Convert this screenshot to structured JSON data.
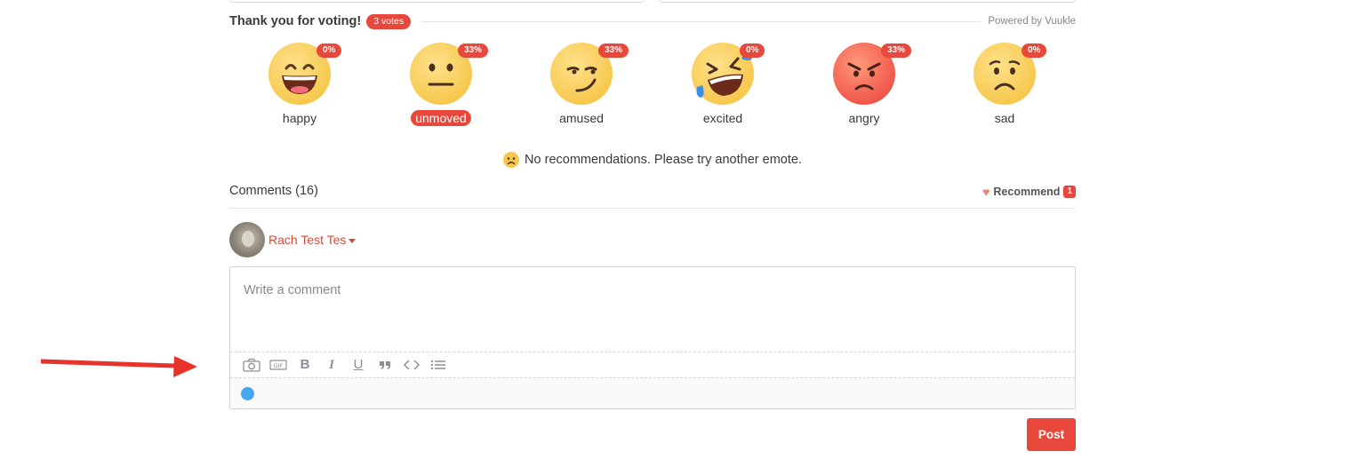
{
  "vote_header": {
    "title": "Thank you for voting!",
    "votes_badge": "3 votes",
    "powered_by": "Powered by Vuukle"
  },
  "emotes": [
    {
      "name": "happy",
      "percent": "0%",
      "icon": "grinning-face-icon",
      "selected": false
    },
    {
      "name": "unmoved",
      "percent": "33%",
      "icon": "neutral-face-icon",
      "selected": true
    },
    {
      "name": "amused",
      "percent": "33%",
      "icon": "smirking-face-icon",
      "selected": false
    },
    {
      "name": "excited",
      "percent": "0%",
      "icon": "rofl-face-icon",
      "selected": false
    },
    {
      "name": "angry",
      "percent": "33%",
      "icon": "angry-face-icon",
      "selected": false
    },
    {
      "name": "sad",
      "percent": "0%",
      "icon": "worried-face-icon",
      "selected": false
    }
  ],
  "recommendations": {
    "icon": "frowning-face-icon",
    "message": "No recommendations. Please try another emote."
  },
  "comments": {
    "count_label": "Comments (16)",
    "recommend_label": "Recommend",
    "recommend_count": "1"
  },
  "user": {
    "name": "Rach Test Tes"
  },
  "editor": {
    "placeholder": "Write a comment",
    "value": "",
    "toolbar": [
      "camera-icon",
      "gif-icon",
      "bold-icon",
      "italic-icon",
      "underline-icon",
      "quote-icon",
      "code-icon",
      "list-icon"
    ]
  },
  "post_button": "Post",
  "colors": {
    "accent": "#e8473b",
    "status_dot": "#44a8ee",
    "annotation_arrow": "#e8332a"
  }
}
